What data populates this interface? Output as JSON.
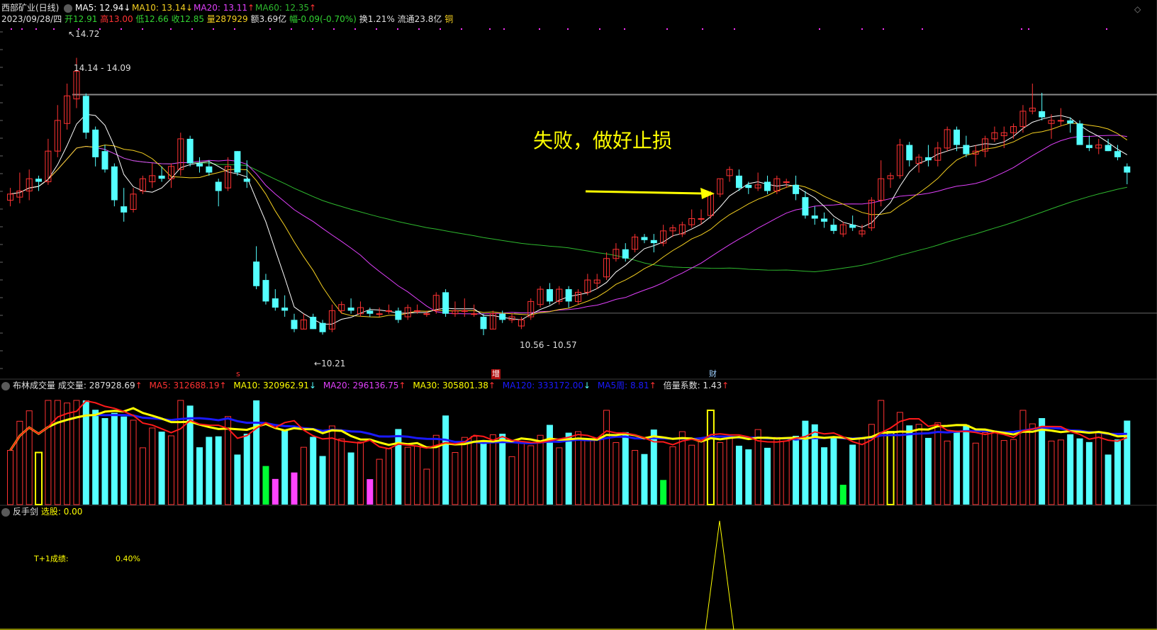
{
  "colors": {
    "up": "#ff3232",
    "down": "#54ffff",
    "ma5": "#ffffff",
    "ma10": "#f5d020",
    "ma20": "#e040fb",
    "ma60": "#2eb82e",
    "vol_ma5": "#ff1a1a",
    "vol_ma10": "#ffff00",
    "vol_ma20": "#1a1aff",
    "vol_highlight": "#ffff00",
    "vol_green": "#00ff33",
    "vol_magenta": "#ff44ff",
    "annotation": "#ffff00",
    "price_line": "#8a8a8a",
    "marker": "#ff33ff"
  },
  "main": {
    "stock_name": "西部矿业(日线)",
    "ma5_label": "MA5: 12.94",
    "ma5_arrow": "↓",
    "ma10_label": "MA10: 13.14",
    "ma10_arrow": "↓",
    "ma20_label": "MA20: 13.11",
    "ma20_arrow": "↑",
    "ma60_label": "MA60: 12.35",
    "ma60_arrow": "↑",
    "date": "2023/09/28/四",
    "open": "开12.91",
    "high": "高13.00",
    "low": "低12.66",
    "close": "收12.85",
    "volume": "量287929",
    "amount": "额3.69亿",
    "change": "幅-0.09(-0.70%)",
    "turnover": "换1.21%",
    "float_cap": "流通23.8亿",
    "sector": "铜",
    "high_label": "14.72",
    "resistance_label": "14.14 - 14.09",
    "support_label": "10.56 - 10.57",
    "low_label": "10.21",
    "annotation": "失败，做好止损",
    "event_s": "s",
    "event_zeng": "增",
    "event_cai": "财"
  },
  "volume_panel": {
    "title": "布林成交量",
    "vol_label": "成交量: 287928.69",
    "vol_arrow": "↑",
    "ma5_label": "MA5: 312688.19",
    "ma5_arrow": "↑",
    "ma10_label": "MA10: 320962.91",
    "ma10_arrow": "↓",
    "ma20_label": "MA20: 296136.75",
    "ma20_arrow": "↑",
    "ma30_label": "MA30: 305801.38",
    "ma30_arrow": "↑",
    "ma120_label": "MA120: 333172.00",
    "ma120_arrow": "↓",
    "mav_label": "MA5周: 8.81",
    "mav_arrow": "↑",
    "ratio_label": "倍量系数: 1.43",
    "ratio_arrow": "↑"
  },
  "indicator_panel": {
    "title": "反手剑",
    "select_label": "选股: 0.00",
    "t1_label": "T+1成绩:",
    "t1_value": "0.40%"
  },
  "chart_data": {
    "type": "candlestick",
    "price_range": [
      9.6,
      15.2
    ],
    "candles": [
      [
        12.4,
        12.6,
        12.3,
        12.5
      ],
      [
        12.45,
        12.85,
        12.35,
        12.55
      ],
      [
        12.55,
        12.9,
        12.4,
        12.75
      ],
      [
        12.75,
        12.8,
        12.55,
        12.7
      ],
      [
        12.7,
        13.4,
        12.65,
        13.2
      ],
      [
        13.2,
        13.95,
        13.1,
        13.7
      ],
      [
        13.65,
        14.3,
        13.55,
        14.1
      ],
      [
        14.05,
        14.72,
        13.9,
        14.5
      ],
      [
        14.1,
        14.14,
        13.4,
        13.5
      ],
      [
        13.55,
        13.6,
        12.95,
        13.1
      ],
      [
        13.2,
        13.3,
        12.85,
        12.9
      ],
      [
        12.95,
        13.0,
        12.3,
        12.4
      ],
      [
        12.3,
        12.6,
        12.05,
        12.2
      ],
      [
        12.25,
        12.6,
        12.2,
        12.5
      ],
      [
        12.55,
        12.8,
        12.5,
        12.75
      ],
      [
        12.7,
        13.0,
        12.6,
        12.8
      ],
      [
        12.8,
        12.95,
        12.7,
        12.75
      ],
      [
        12.75,
        13.0,
        12.6,
        12.95
      ],
      [
        12.9,
        13.5,
        12.8,
        13.4
      ],
      [
        13.4,
        13.45,
        12.95,
        13.0
      ],
      [
        13.0,
        13.1,
        12.85,
        12.95
      ],
      [
        12.95,
        13.05,
        12.8,
        12.85
      ],
      [
        12.7,
        12.75,
        12.3,
        12.55
      ],
      [
        12.6,
        13.1,
        12.55,
        12.95
      ],
      [
        13.2,
        13.2,
        12.8,
        12.85
      ],
      [
        12.75,
        13.05,
        12.6,
        12.7
      ],
      [
        11.4,
        11.65,
        10.95,
        11.0
      ],
      [
        11.1,
        11.2,
        10.7,
        10.75
      ],
      [
        10.8,
        10.95,
        10.6,
        10.65
      ],
      [
        10.65,
        10.85,
        10.5,
        10.6
      ],
      [
        10.45,
        10.55,
        10.25,
        10.3
      ],
      [
        10.3,
        10.55,
        10.3,
        10.45
      ],
      [
        10.5,
        10.55,
        10.3,
        10.3
      ],
      [
        10.4,
        10.45,
        10.21,
        10.25
      ],
      [
        10.3,
        10.7,
        10.25,
        10.6
      ],
      [
        10.6,
        10.75,
        10.55,
        10.7
      ],
      [
        10.65,
        10.8,
        10.55,
        10.6
      ],
      [
        10.55,
        10.75,
        10.5,
        10.65
      ],
      [
        10.6,
        10.65,
        10.5,
        10.55
      ],
      [
        10.55,
        10.65,
        10.5,
        10.55
      ],
      [
        10.6,
        10.7,
        10.55,
        10.6
      ],
      [
        10.6,
        10.65,
        10.4,
        10.45
      ],
      [
        10.5,
        10.7,
        10.45,
        10.65
      ],
      [
        10.6,
        10.7,
        10.55,
        10.6
      ],
      [
        10.55,
        10.6,
        10.5,
        10.55
      ],
      [
        10.6,
        10.9,
        10.55,
        10.85
      ],
      [
        10.9,
        10.95,
        10.5,
        10.55
      ],
      [
        10.55,
        10.75,
        10.5,
        10.6
      ],
      [
        10.6,
        10.8,
        10.5,
        10.6
      ],
      [
        10.55,
        10.7,
        10.5,
        10.55
      ],
      [
        10.5,
        10.55,
        10.2,
        10.3
      ],
      [
        10.3,
        10.6,
        10.3,
        10.55
      ],
      [
        10.55,
        10.6,
        10.4,
        10.45
      ],
      [
        10.45,
        10.55,
        10.4,
        10.5
      ],
      [
        10.35,
        10.5,
        10.3,
        10.45
      ],
      [
        10.5,
        10.8,
        10.45,
        10.75
      ],
      [
        10.7,
        11.0,
        10.65,
        10.95
      ],
      [
        10.95,
        11.05,
        10.7,
        10.75
      ],
      [
        10.75,
        11.0,
        10.7,
        10.95
      ],
      [
        10.95,
        11.0,
        10.65,
        10.75
      ],
      [
        10.75,
        10.95,
        10.7,
        10.9
      ],
      [
        10.9,
        11.2,
        10.85,
        11.1
      ],
      [
        11.05,
        11.2,
        10.95,
        11.1
      ],
      [
        11.15,
        11.55,
        11.1,
        11.45
      ],
      [
        11.45,
        11.7,
        11.4,
        11.6
      ],
      [
        11.6,
        11.7,
        11.4,
        11.45
      ],
      [
        11.6,
        11.85,
        11.55,
        11.8
      ],
      [
        11.8,
        11.85,
        11.7,
        11.75
      ],
      [
        11.75,
        11.85,
        11.55,
        11.7
      ],
      [
        11.7,
        12.0,
        11.65,
        11.9
      ],
      [
        11.9,
        12.0,
        11.8,
        11.95
      ],
      [
        11.85,
        12.05,
        11.8,
        12.0
      ],
      [
        12.0,
        12.25,
        11.95,
        12.1
      ],
      [
        12.1,
        12.25,
        12.0,
        12.1
      ],
      [
        12.15,
        12.55,
        12.1,
        12.5
      ],
      [
        12.5,
        12.75,
        12.45,
        12.75
      ],
      [
        12.8,
        12.95,
        12.7,
        12.9
      ],
      [
        12.8,
        12.9,
        12.55,
        12.6
      ],
      [
        12.65,
        12.7,
        12.5,
        12.6
      ],
      [
        12.6,
        12.85,
        12.55,
        12.65
      ],
      [
        12.7,
        12.8,
        12.5,
        12.55
      ],
      [
        12.55,
        12.8,
        12.5,
        12.75
      ],
      [
        12.7,
        12.75,
        12.6,
        12.7
      ],
      [
        12.65,
        12.8,
        12.4,
        12.5
      ],
      [
        12.45,
        12.55,
        12.1,
        12.15
      ],
      [
        12.15,
        12.3,
        12.0,
        12.1
      ],
      [
        12.1,
        12.2,
        11.95,
        12.05
      ],
      [
        12.0,
        12.1,
        11.85,
        11.9
      ],
      [
        11.85,
        12.05,
        11.8,
        12.0
      ],
      [
        12.0,
        12.15,
        11.9,
        11.95
      ],
      [
        11.85,
        12.0,
        11.8,
        11.9
      ],
      [
        11.95,
        12.45,
        11.9,
        12.4
      ],
      [
        12.4,
        13.05,
        12.3,
        12.75
      ],
      [
        12.75,
        12.85,
        12.6,
        12.8
      ],
      [
        12.8,
        13.4,
        12.75,
        13.3
      ],
      [
        13.3,
        13.35,
        12.95,
        13.05
      ],
      [
        13.0,
        13.15,
        12.85,
        13.1
      ],
      [
        13.1,
        13.3,
        12.95,
        13.05
      ],
      [
        13.05,
        13.35,
        12.95,
        13.25
      ],
      [
        13.25,
        13.6,
        13.2,
        13.55
      ],
      [
        13.55,
        13.6,
        13.2,
        13.3
      ],
      [
        13.3,
        13.45,
        13.1,
        13.15
      ],
      [
        13.15,
        13.3,
        12.95,
        13.2
      ],
      [
        13.2,
        13.45,
        13.1,
        13.4
      ],
      [
        13.4,
        13.6,
        13.35,
        13.5
      ],
      [
        13.45,
        13.6,
        13.25,
        13.5
      ],
      [
        13.5,
        13.65,
        13.4,
        13.6
      ],
      [
        13.6,
        13.95,
        13.5,
        13.85
      ],
      [
        13.85,
        14.3,
        13.8,
        13.9
      ],
      [
        13.85,
        14.15,
        13.7,
        13.75
      ],
      [
        13.65,
        13.8,
        13.4,
        13.7
      ],
      [
        13.7,
        13.9,
        13.6,
        13.7
      ],
      [
        13.7,
        13.75,
        13.5,
        13.65
      ],
      [
        13.65,
        13.7,
        13.3,
        13.3
      ],
      [
        13.3,
        13.45,
        13.2,
        13.25
      ],
      [
        13.25,
        13.4,
        13.15,
        13.3
      ],
      [
        13.3,
        13.4,
        13.2,
        13.2
      ],
      [
        13.2,
        13.3,
        13.05,
        13.1
      ],
      [
        12.95,
        13.0,
        12.66,
        12.85
      ]
    ]
  }
}
